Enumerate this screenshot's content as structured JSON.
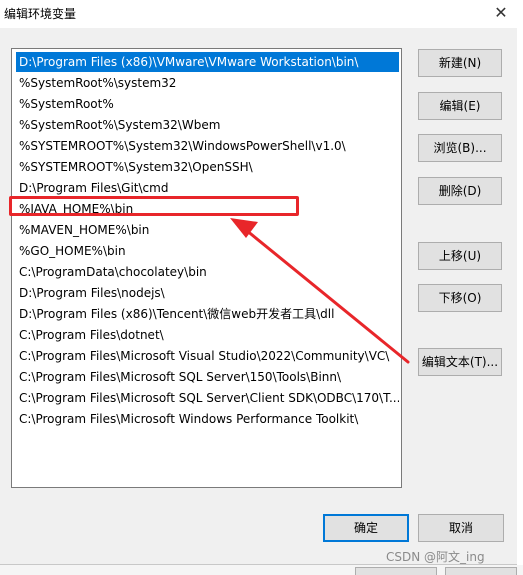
{
  "window": {
    "title": "编辑环境变量",
    "close_glyph": "✕"
  },
  "list": {
    "selected_index": 0,
    "items": [
      "D:\\Program Files (x86)\\VMware\\VMware Workstation\\bin\\",
      "%SystemRoot%\\system32",
      "%SystemRoot%",
      "%SystemRoot%\\System32\\Wbem",
      "%SYSTEMROOT%\\System32\\WindowsPowerShell\\v1.0\\",
      "%SYSTEMROOT%\\System32\\OpenSSH\\",
      "D:\\Program Files\\Git\\cmd",
      "%JAVA_HOME%\\bin",
      "%MAVEN_HOME%\\bin",
      "%GO_HOME%\\bin",
      "C:\\ProgramData\\chocolatey\\bin",
      "D:\\Program Files\\nodejs\\",
      "D:\\Program Files (x86)\\Tencent\\微信web开发者工具\\dll",
      "C:\\Program Files\\dotnet\\",
      "C:\\Program Files\\Microsoft Visual Studio\\2022\\Community\\VC\\",
      "C:\\Program Files\\Microsoft SQL Server\\150\\Tools\\Binn\\",
      "C:\\Program Files\\Microsoft SQL Server\\Client SDK\\ODBC\\170\\T...",
      "C:\\Program Files\\Microsoft Windows Performance Toolkit\\"
    ]
  },
  "buttons": {
    "new": "新建(N)",
    "edit": "编辑(E)",
    "browse": "浏览(B)...",
    "delete": "删除(D)",
    "move_up": "上移(U)",
    "move_down": "下移(O)",
    "edit_text": "编辑文本(T)...",
    "ok": "确定",
    "cancel": "取消"
  },
  "annotation": {
    "highlight_color": "#e8262a"
  },
  "watermark": "CSDN @阿文_ing"
}
